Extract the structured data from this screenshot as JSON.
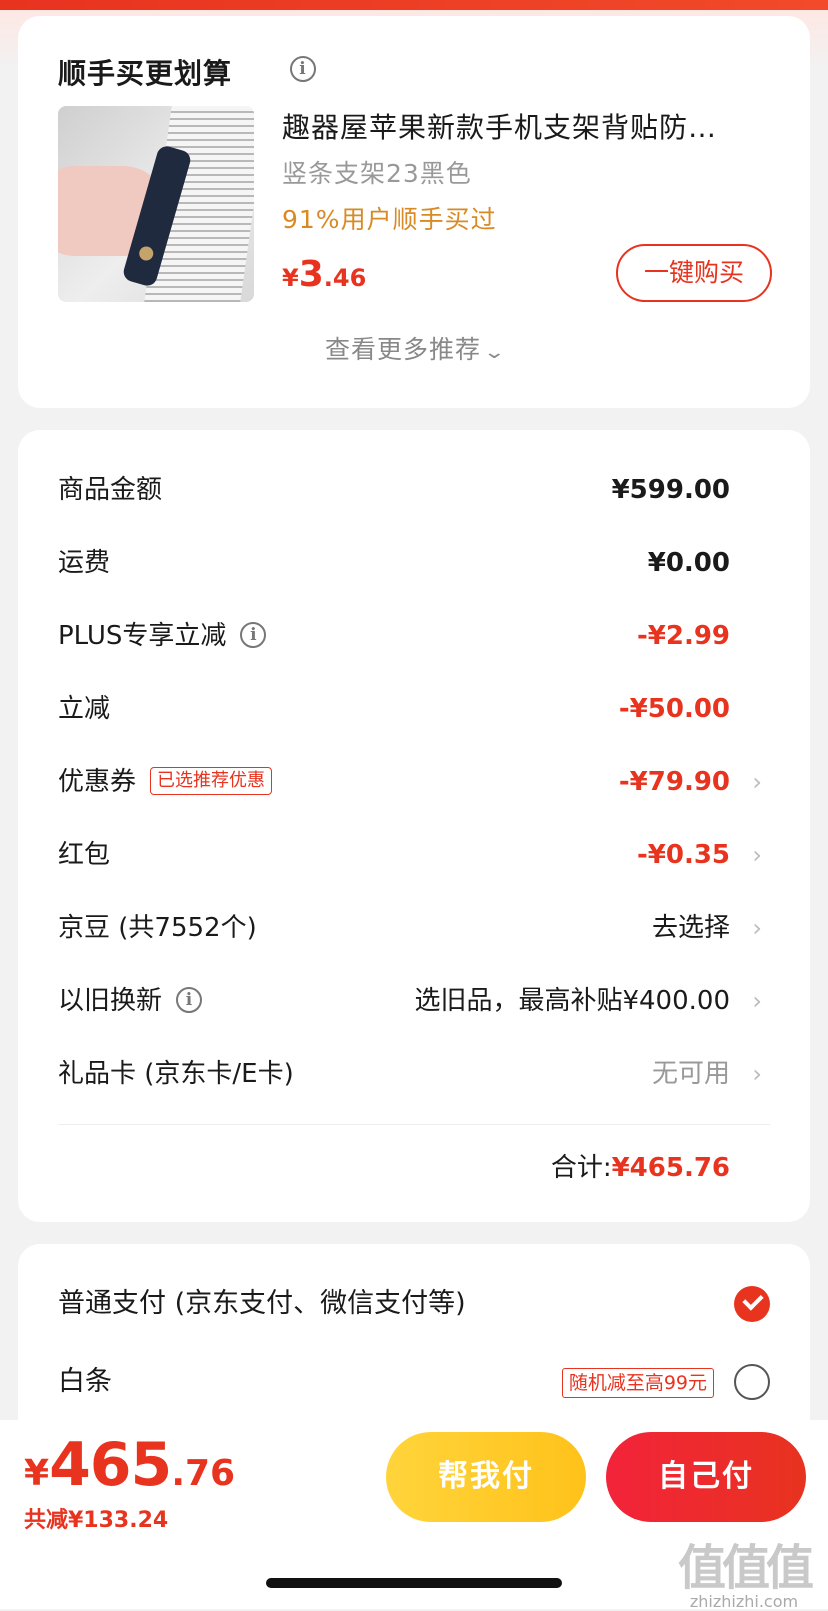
{
  "recommend": {
    "title": "顺手买更划算",
    "product": {
      "name": "趣器屋苹果新款手机支架背贴防…",
      "spec": "竖条支架23黑色",
      "buyers": "91%用户顺手买过",
      "price_symbol": "¥",
      "price_int": "3",
      "price_dec": ".46",
      "buy_label": "一键购买"
    },
    "more_label": "查看更多推荐"
  },
  "summary": {
    "rows": [
      {
        "label": "商品金额",
        "value": "¥599.00"
      },
      {
        "label": "运费",
        "value": "¥0.00"
      },
      {
        "label": "PLUS专享立减",
        "value": "-¥2.99"
      },
      {
        "label": "立减",
        "value": "-¥50.00"
      },
      {
        "label": "优惠券",
        "tag": "已选推荐优惠",
        "value": "-¥79.90"
      },
      {
        "label": "红包",
        "value": "-¥0.35"
      },
      {
        "label": "京豆 (共7552个)",
        "value": "去选择"
      },
      {
        "label": "以旧换新",
        "value": "选旧品，最高补贴¥400.00"
      },
      {
        "label": "礼品卡 (京东卡/E卡)",
        "value": "无可用"
      }
    ],
    "total_label": "合计:",
    "total_value": "¥465.76"
  },
  "payment": {
    "options": [
      {
        "label": "普通支付 (京东支付、微信支付等)",
        "selected": true
      },
      {
        "label": "白条",
        "tag": "随机减至高99元",
        "selected": false
      }
    ]
  },
  "footer": {
    "price_symbol": "¥",
    "price_int": "465",
    "price_dec": ".76",
    "saved": "共减¥133.24",
    "help_pay": "帮我付",
    "self_pay": "自己付"
  },
  "watermark": {
    "logo": "值值值",
    "url": "zhizhizhi.com"
  },
  "colors": {
    "accent": "#e8331f",
    "orange": "#d98a24",
    "help_button": "#ffc21a"
  }
}
